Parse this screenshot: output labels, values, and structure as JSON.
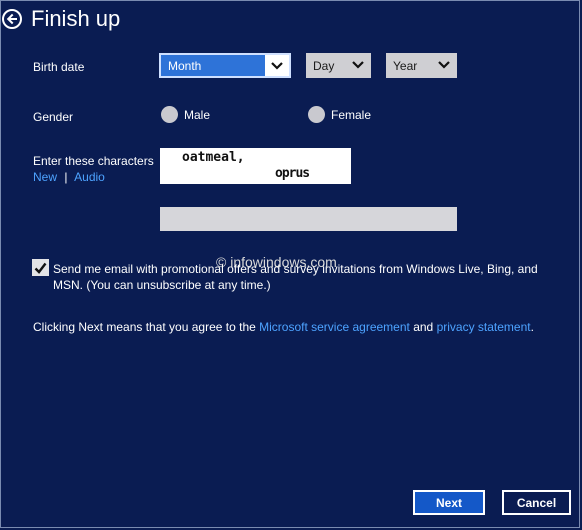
{
  "header": {
    "title": "Finish up"
  },
  "birth_date": {
    "label": "Birth date",
    "month": "Month",
    "day": "Day",
    "year": "Year"
  },
  "gender": {
    "label": "Gender",
    "options": [
      "Male",
      "Female"
    ]
  },
  "captcha": {
    "label": "Enter these characters",
    "new_link": "New",
    "separator": "|",
    "audio_link": "Audio",
    "image_word1": "oatmeal,",
    "image_word2": "oprus"
  },
  "watermark": "© infowindows.com",
  "consent": {
    "checked": true,
    "text": "Send me email with promotional offers and survey invitations from Windows Live, Bing, and MSN. (You can unsubscribe at any time.)"
  },
  "agreement": {
    "prefix": "Clicking Next means that you agree to the ",
    "service_link": "Microsoft service agreement",
    "middle": " and ",
    "privacy_link": "privacy statement",
    "suffix": "."
  },
  "buttons": {
    "next": "Next",
    "cancel": "Cancel"
  },
  "colors": {
    "background": "#0a1c52",
    "accent": "#1458c8",
    "link": "#4da3ff"
  }
}
